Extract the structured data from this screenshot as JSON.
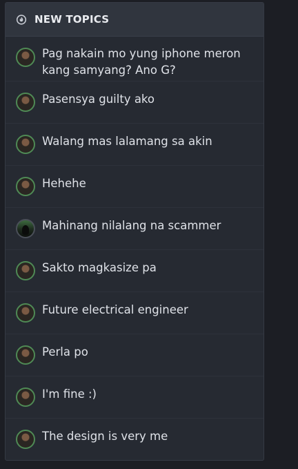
{
  "panel": {
    "title": "NEW TOPICS",
    "icon": "fire-icon"
  },
  "topics": [
    {
      "title": "Pag nakain mo yung iphone meron kang samyang? Ano G?",
      "avatar": "avatar"
    },
    {
      "title": "Pasensya guilty ako",
      "avatar": "avatar"
    },
    {
      "title": "Walang mas lalamang sa akin",
      "avatar": "avatar"
    },
    {
      "title": "Hehehe",
      "avatar": "avatar"
    },
    {
      "title": "Mahinang nilalang na scammer",
      "avatar": "avatar-alt"
    },
    {
      "title": "Sakto magkasize pa",
      "avatar": "avatar"
    },
    {
      "title": "Future electrical engineer",
      "avatar": "avatar"
    },
    {
      "title": "Perla po",
      "avatar": "avatar"
    },
    {
      "title": "I'm fine :)",
      "avatar": "avatar"
    },
    {
      "title": "The design is very me",
      "avatar": "avatar"
    }
  ]
}
